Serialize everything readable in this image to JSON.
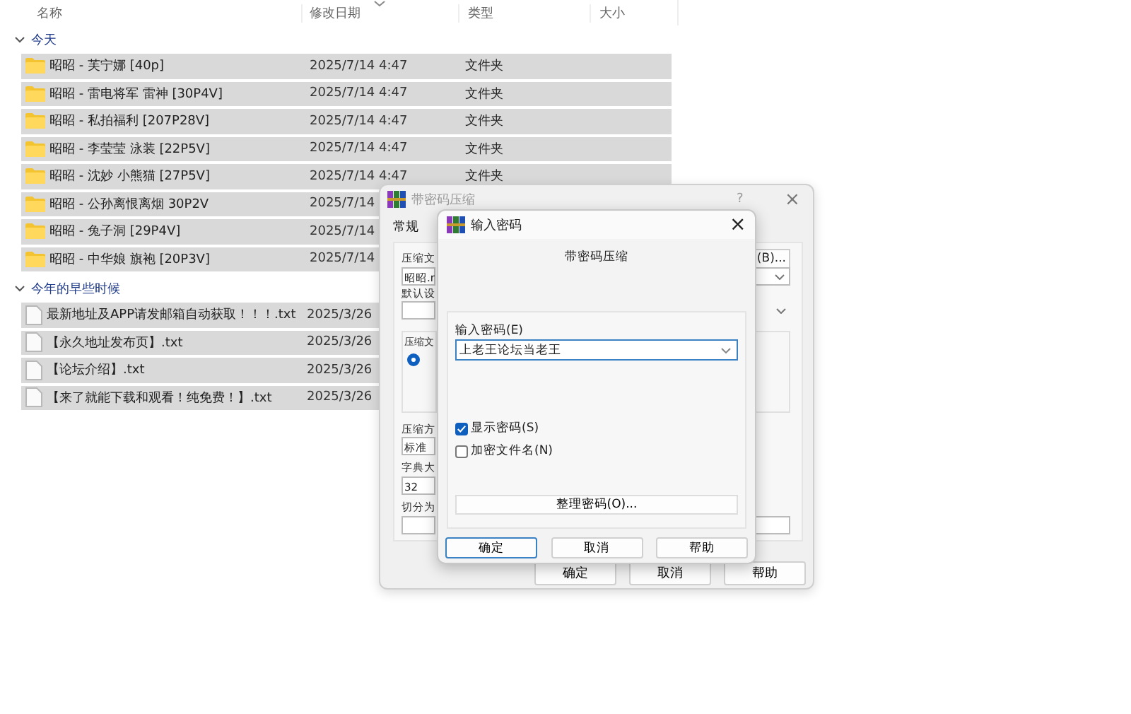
{
  "explorer": {
    "columns": [
      "名称",
      "修改日期",
      "类型",
      "大小"
    ],
    "groups": [
      {
        "label": "今天",
        "expanded": true,
        "rows": [
          {
            "kind": "folder",
            "name": "昭昭 - 芙宁娜 [40p]",
            "date": "2025/7/14 4:47",
            "type": "文件夹",
            "selected": true
          },
          {
            "kind": "folder",
            "name": "昭昭 - 雷电将军 雷神 [30P4V]",
            "date": "2025/7/14 4:47",
            "type": "文件夹",
            "selected": true
          },
          {
            "kind": "folder",
            "name": "昭昭 - 私拍福利 [207P28V]",
            "date": "2025/7/14 4:47",
            "type": "文件夹",
            "selected": true
          },
          {
            "kind": "folder",
            "name": "昭昭 - 李莹莹 泳装 [22P5V]",
            "date": "2025/7/14 4:47",
            "type": "文件夹",
            "selected": true
          },
          {
            "kind": "folder",
            "name": "昭昭 - 沈妙 小熊猫 [27P5V]",
            "date": "2025/7/14 4:47",
            "type": "文件夹",
            "selected": true
          },
          {
            "kind": "folder",
            "name": "昭昭 - 公孙离恨离烟 30P2V",
            "date": "2025/7/14",
            "selected": true
          },
          {
            "kind": "folder",
            "name": "昭昭 - 兔子洞 [29P4V]",
            "date": "2025/7/14",
            "selected": true
          },
          {
            "kind": "folder",
            "name": "昭昭 - 中华娘 旗袍 [20P3V]",
            "date": "2025/7/14",
            "selected": true
          }
        ]
      },
      {
        "label": "今年的早些时候",
        "expanded": true,
        "rows": [
          {
            "kind": "file",
            "name": "最新地址及APP请发邮箱自动获取！！！.txt",
            "date": "2025/3/26",
            "selected": true
          },
          {
            "kind": "file",
            "name": "【永久地址发布页】.txt",
            "date": "2025/3/26",
            "selected": true
          },
          {
            "kind": "file",
            "name": "【论坛介绍】.txt",
            "date": "2025/3/26",
            "selected": true
          },
          {
            "kind": "file",
            "name": "【来了就能下载和观看！纯免费！】.txt",
            "date": "2025/3/26",
            "selected": true
          }
        ]
      }
    ]
  },
  "archive_dialog": {
    "title": "带密码压缩",
    "help": "?",
    "close": "×",
    "tabs": [
      {
        "label": "常规",
        "selected": true
      }
    ],
    "archive_name_label": "压缩文",
    "browse_button": "(B)...",
    "archive_name": "昭昭.r",
    "profile_label": "默认设",
    "format_label": "压缩文",
    "format_radio_selected": true,
    "method_label": "压缩方",
    "method": "标准",
    "dictionary_label": "字典大",
    "dictionary": "32",
    "split_label": "切分为",
    "buttons": [
      "确定",
      "取消",
      "帮助"
    ]
  },
  "password_dialog": {
    "title": "输入密码",
    "close": "×",
    "subtitle": "带密码压缩",
    "password_label": "输入密码(E)",
    "password": "上老王论坛当老王",
    "options": [
      {
        "label": "显示密码(S)",
        "checked": true
      },
      {
        "label": "加密文件名(N)",
        "checked": false
      }
    ],
    "organize_button": "整理密码(O)...",
    "buttons": [
      {
        "label": "确定",
        "default": true
      },
      {
        "label": "取消",
        "default": false
      },
      {
        "label": "帮助",
        "default": false
      }
    ]
  }
}
